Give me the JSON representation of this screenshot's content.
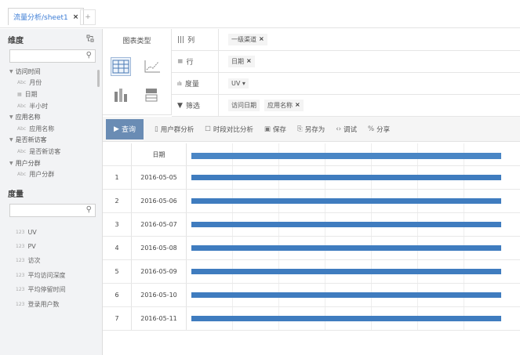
{
  "tabs": [
    {
      "label": "流量分析/sheet1",
      "close": "×"
    }
  ],
  "tab_add": "+",
  "left": {
    "dimensions_title": "维度",
    "dimensions": [
      {
        "group": "访问时间",
        "items": [
          "月份",
          "日期",
          "半小时"
        ]
      },
      {
        "group": "应用名称",
        "items": [
          "应用名称"
        ]
      },
      {
        "group": "是否新访客",
        "items": [
          "是否新访客"
        ]
      },
      {
        "group": "用户分群",
        "items": [
          "用户分群"
        ]
      }
    ],
    "measures_title": "度量",
    "measures": [
      "UV",
      "PV",
      "访次",
      "平均访问深度",
      "平均停留时间",
      "登录用户数"
    ],
    "search_icon": "search-icon"
  },
  "chart_type": {
    "title": "图表类型"
  },
  "config": {
    "columns": {
      "label": "列",
      "chips": [
        "一级渠道"
      ]
    },
    "rows": {
      "label": "行",
      "chips": [
        "日期"
      ]
    },
    "measure": {
      "label": "度量",
      "value": "UV ▾"
    },
    "filter": {
      "label": "筛选",
      "chips": [
        "访问日期",
        "应用名称"
      ]
    }
  },
  "toolbar": {
    "query": "查询",
    "user_group": "用户群分析",
    "compare": "时段对比分析",
    "save": "保存",
    "save_as": "另存为",
    "debug": "调试",
    "share": "分享"
  },
  "table": {
    "header_date": "日期",
    "rows": [
      {
        "num": "1",
        "date": "2016-05-05"
      },
      {
        "num": "2",
        "date": "2016-05-06"
      },
      {
        "num": "3",
        "date": "2016-05-07"
      },
      {
        "num": "4",
        "date": "2016-05-08"
      },
      {
        "num": "5",
        "date": "2016-05-09"
      },
      {
        "num": "6",
        "date": "2016-05-10"
      },
      {
        "num": "7",
        "date": "2016-05-11"
      }
    ]
  },
  "colors": {
    "accent": "#3a7bd5",
    "query_button": "#6a8cb4",
    "bar": "#3f7cbf"
  }
}
